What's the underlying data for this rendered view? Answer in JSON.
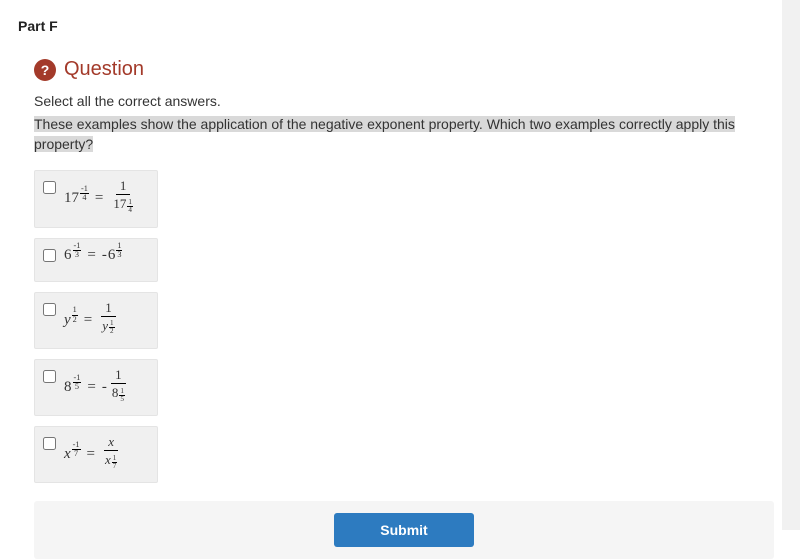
{
  "part_label": "Part F",
  "question_icon": "?",
  "question_heading": "Question",
  "instruction": "Select all the correct answers.",
  "prompt": "These examples show the application of the negative exponent property. Which two examples correctly apply this property?",
  "options": [
    {
      "left": {
        "base": "17",
        "exp_sign": "-",
        "exp_num": "1",
        "exp_den": "4",
        "italic": false
      },
      "right": {
        "type": "frac_one_over_base",
        "num_prefix": "",
        "num": "1",
        "base": "17",
        "exp_sign": "",
        "exp_num": "1",
        "exp_den": "4",
        "italic": false
      }
    },
    {
      "left": {
        "base": "6",
        "exp_sign": "-",
        "exp_num": "1",
        "exp_den": "3",
        "italic": false
      },
      "right": {
        "type": "neg_base",
        "base": "6",
        "exp_sign": "",
        "exp_num": "1",
        "exp_den": "3",
        "italic": false
      }
    },
    {
      "left": {
        "base": "y",
        "exp_sign": "",
        "exp_num": "1",
        "exp_den": "2",
        "italic": true
      },
      "right": {
        "type": "frac_one_over_base",
        "num_prefix": "",
        "num": "1",
        "base": "y",
        "exp_sign": "",
        "exp_num": "1",
        "exp_den": "2",
        "italic": true
      }
    },
    {
      "left": {
        "base": "8",
        "exp_sign": "-",
        "exp_num": "1",
        "exp_den": "5",
        "italic": false
      },
      "right": {
        "type": "frac_one_over_base",
        "num_prefix": "-",
        "num": "1",
        "base": "8",
        "exp_sign": "",
        "exp_num": "1",
        "exp_den": "5",
        "italic": false
      }
    },
    {
      "left": {
        "base": "x",
        "exp_sign": "-",
        "exp_num": "1",
        "exp_den": "7",
        "italic": true
      },
      "right": {
        "type": "frac_x_over_base",
        "num_var": "x",
        "base": "x",
        "exp_sign": "",
        "exp_num": "1",
        "exp_den": "7",
        "italic": true
      }
    }
  ],
  "submit_label": "Submit"
}
